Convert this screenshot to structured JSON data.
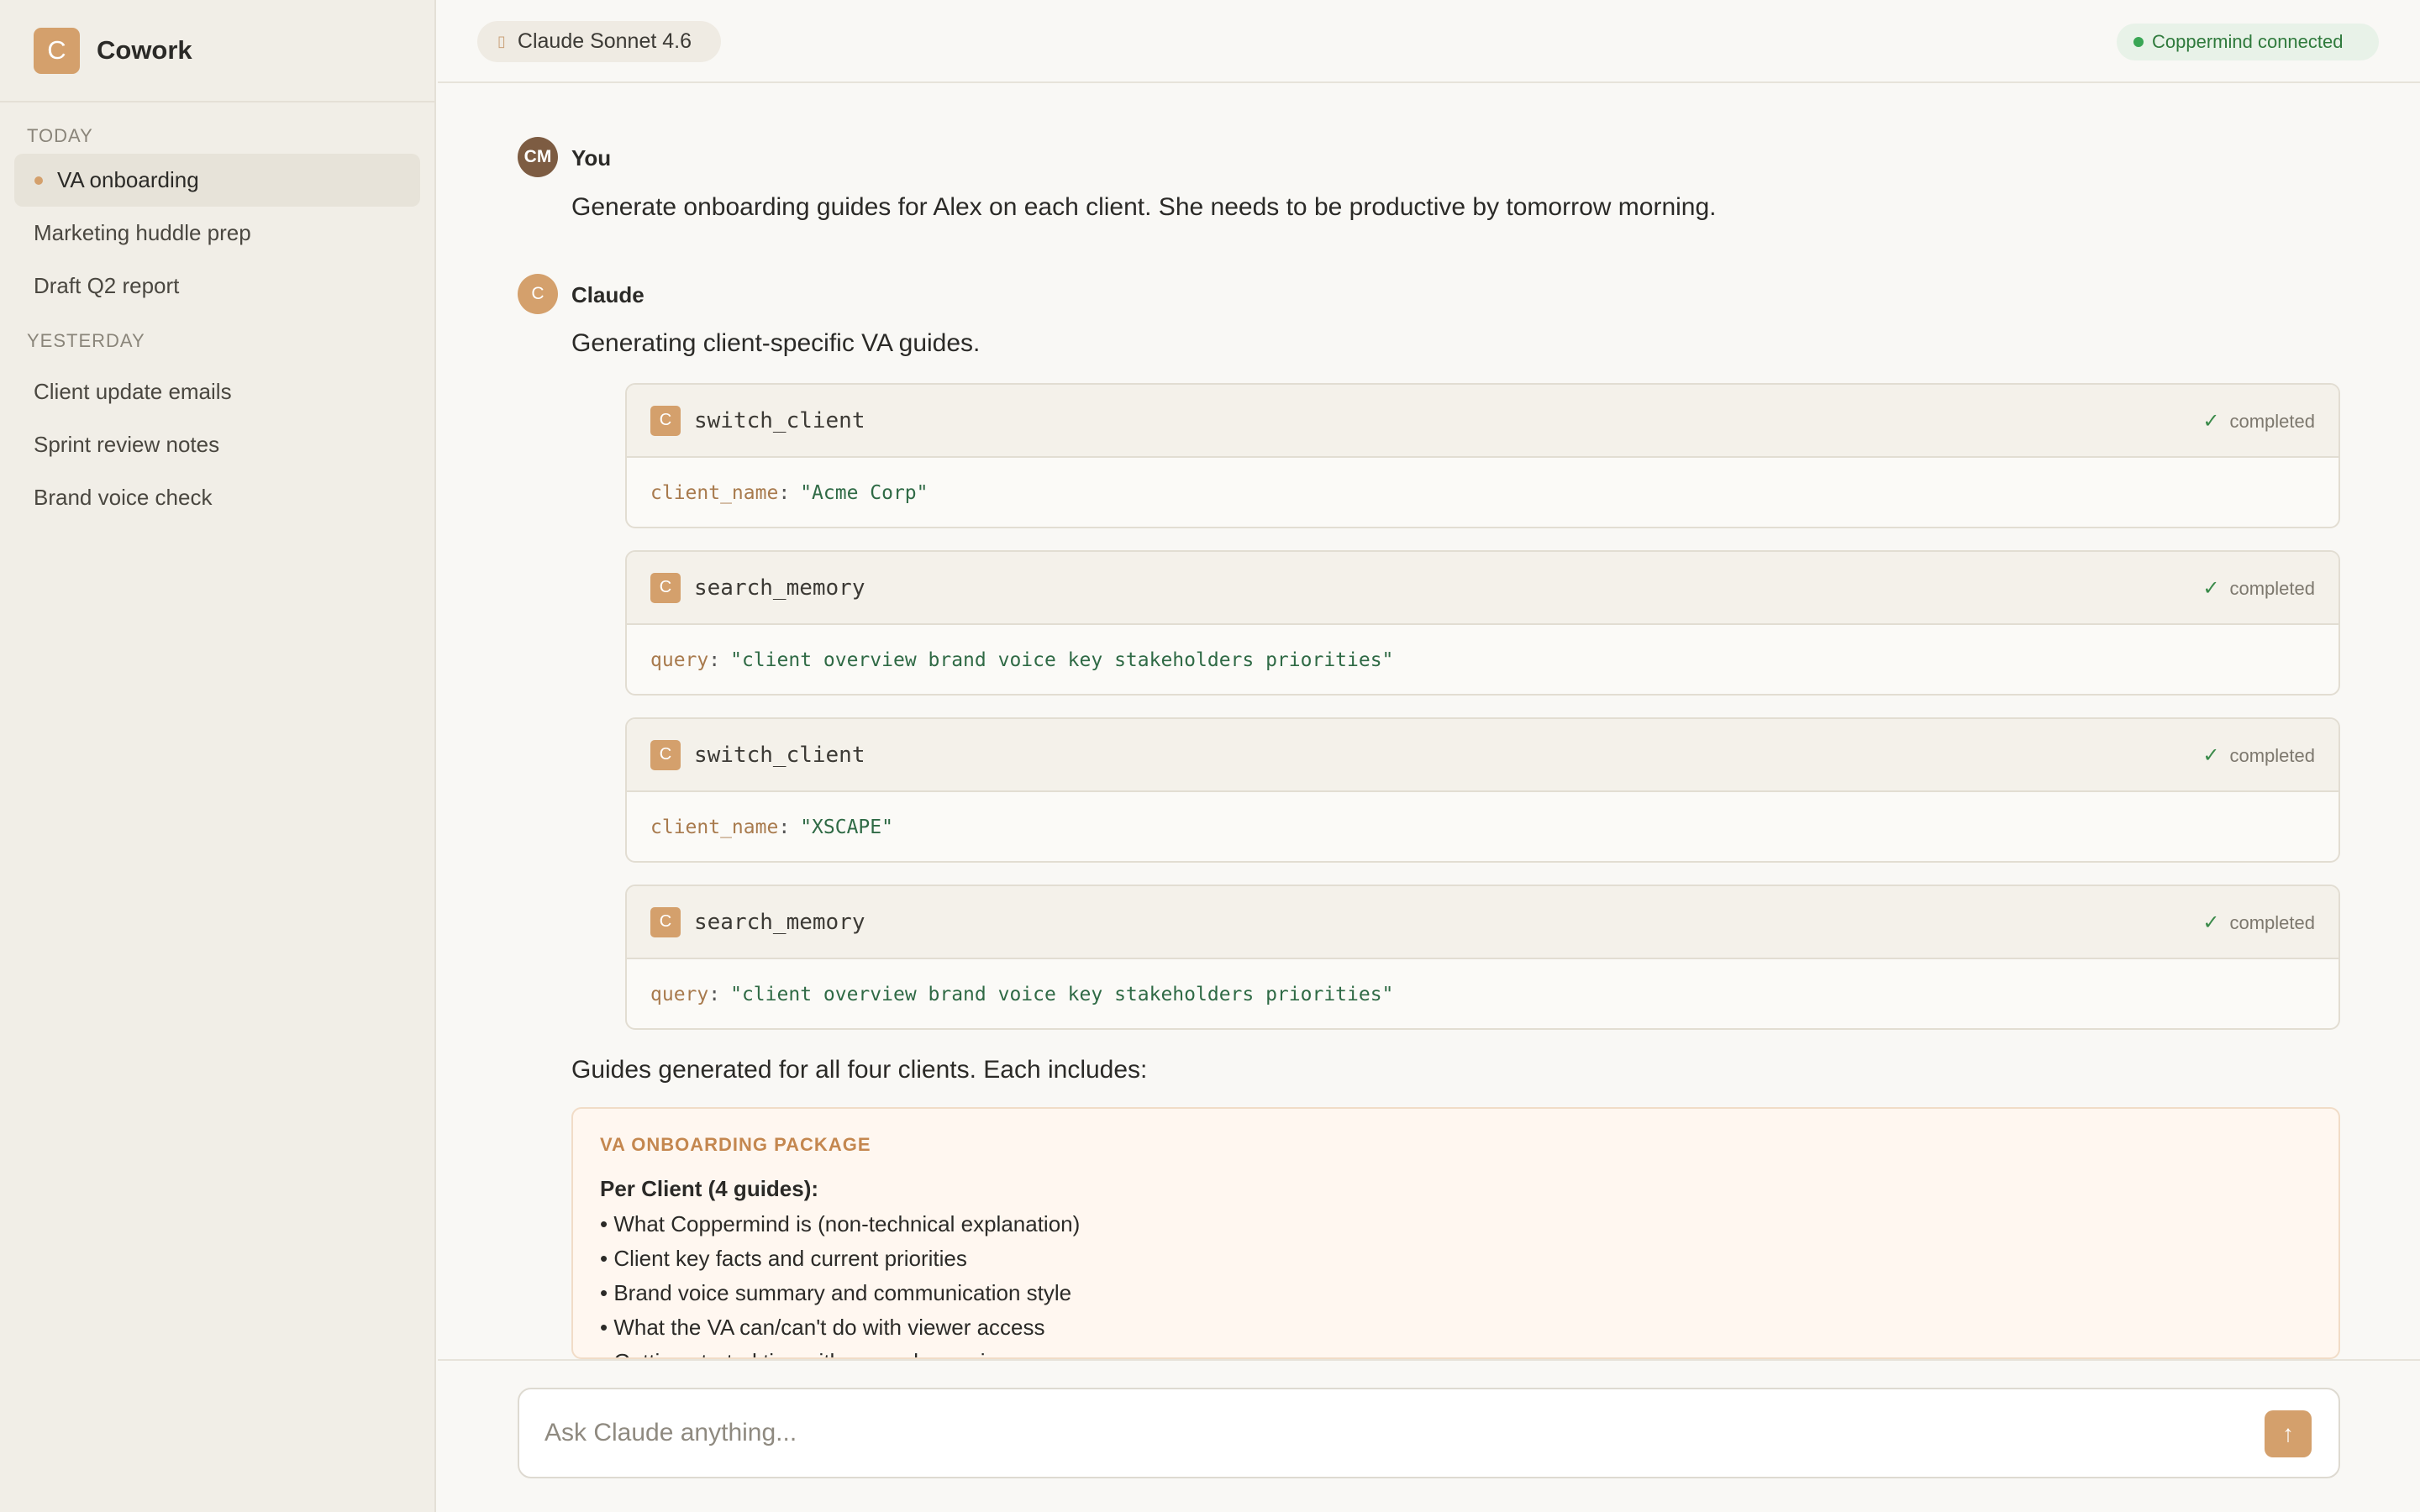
{
  "app": {
    "logo_letter": "C",
    "name": "Cowork"
  },
  "sidebar": {
    "today_label": "TODAY",
    "today_items": [
      {
        "label": "VA onboarding",
        "active": true
      },
      {
        "label": "Marketing huddle prep"
      },
      {
        "label": "Draft Q2 report"
      }
    ],
    "yesterday_label": "YESTERDAY",
    "yesterday_items": [
      {
        "label": "Client update emails"
      },
      {
        "label": "Sprint review notes"
      },
      {
        "label": "Brand voice check"
      }
    ]
  },
  "header": {
    "model": "Claude Sonnet 4.6",
    "connection_status": "Coppermind connected"
  },
  "conversation": {
    "user": {
      "initials": "CM",
      "name": "You",
      "text": "Generate onboarding guides for Alex on each client. She needs to be productive by tomorrow morning."
    },
    "assistant": {
      "initial": "C",
      "name": "Claude",
      "intro": "Generating client-specific VA guides.",
      "tool_calls": [
        {
          "badge": "C",
          "name": "switch_client",
          "status": "completed",
          "arg_key": "client_name",
          "arg_sep": ":",
          "arg_value": "\"Acme Corp\""
        },
        {
          "badge": "C",
          "name": "search_memory",
          "status": "completed",
          "arg_key": "query",
          "arg_sep": ":",
          "arg_value": "\"client overview brand voice key stakeholders priorities\""
        },
        {
          "badge": "C",
          "name": "switch_client",
          "status": "completed",
          "arg_key": "client_name",
          "arg_sep": ":",
          "arg_value": "\"XSCAPE\""
        },
        {
          "badge": "C",
          "name": "search_memory",
          "status": "completed",
          "arg_key": "query",
          "arg_sep": ":",
          "arg_value": "\"client overview brand voice key stakeholders priorities\""
        }
      ],
      "summary": "Guides generated for all four clients. Each includes:",
      "package": {
        "title": "VA ONBOARDING PACKAGE",
        "subtitle": "Per Client (4 guides):",
        "items": [
          "• What Coppermind is (non-technical explanation)",
          "• Client key facts and current priorities",
          "• Brand voice summary and communication style",
          "• What the VA can/can't do with viewer access",
          "• Getting started tips with example queries"
        ]
      }
    }
  },
  "composer": {
    "placeholder": "Ask Claude anything..."
  },
  "icons": {
    "model_icon": "model-icon",
    "connection_icon": "status-dot-icon",
    "check_icon": "check-icon",
    "send_icon": "arrow-up-icon"
  },
  "colors": {
    "accent": "#d4a06c",
    "success": "#3aa655",
    "sidebar_bg": "#f1eee7"
  }
}
